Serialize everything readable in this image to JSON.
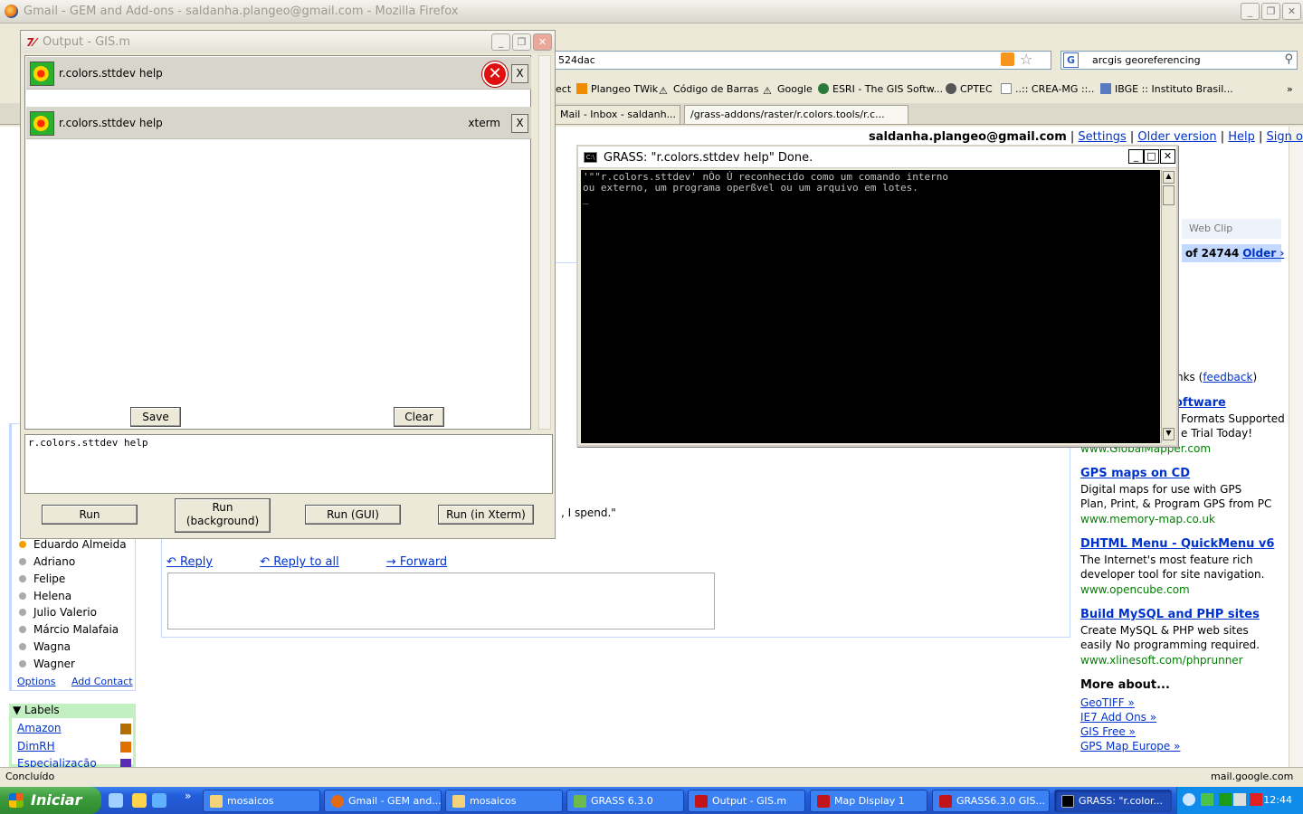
{
  "firefox": {
    "title": "Gmail - GEM and Add-ons - saldanha.plangeo@gmail.com - Mozilla Firefox",
    "url": "524dac",
    "search_value": "arcgis georeferencing",
    "bookmarks": [
      "ect",
      "Plangeo TWik",
      "Código de Barras",
      "Google",
      "ESRI - The GIS Softw...",
      "CPTEC",
      "..:: CREA-MG ::..",
      "IBGE :: Instituto Brasil..."
    ],
    "tabs": [
      "Mail - Inbox - saldanh...",
      "/grass-addons/raster/r.colors.tools/r.c..."
    ],
    "status_left": "Concluído",
    "status_right": "mail.google.com"
  },
  "gmail": {
    "account": "saldanha.plangeo@gmail.com",
    "links": [
      "Settings",
      "Older version",
      "Help",
      "Sign out"
    ],
    "web_clip": "Web Clip",
    "pager_count": "of 24744",
    "pager_older": "Older ›",
    "links_feedback_prefix": "nks",
    "links_feedback": "feedback",
    "spend_text": ", I spend.\"",
    "reply": "Reply",
    "reply_all": "Reply to all",
    "forward": "Forward",
    "contacts": [
      "Eduardo Almeida",
      "Adriano",
      "Felipe",
      "Helena",
      "Julio Valerio",
      "Márcio Malafaia",
      "Wagna",
      "Wagner"
    ],
    "options": "Options",
    "add_contact": "Add Contact",
    "labels_title": "Labels",
    "labels": [
      {
        "name": "Amazon",
        "color": "#b36d00"
      },
      {
        "name": "DimRH",
        "color": "#e07000"
      },
      {
        "name": "Especialização",
        "color": "#5a2bb3"
      }
    ],
    "ads": [
      {
        "title": "oftware",
        "lines": [
          "Formats Supported",
          "e Trial Today!"
        ],
        "url": "www.GlobalMapper.com"
      },
      {
        "title": "GPS maps on CD",
        "lines": [
          "Digital maps for use with GPS",
          "Plan, Print, & Program GPS from PC"
        ],
        "url": "www.memory-map.co.uk"
      },
      {
        "title": "DHTML Menu - QuickMenu v6",
        "lines": [
          "The Internet's most feature rich",
          "developer tool for site navigation."
        ],
        "url": "www.opencube.com"
      },
      {
        "title": "Build MySQL and PHP sites",
        "lines": [
          "Create MySQL & PHP web sites",
          "easily No programming required."
        ],
        "url": "www.xlinesoft.com/phprunner"
      }
    ],
    "more_about": "More about...",
    "more_links": [
      "GeoTIFF »",
      "IE7 Add Ons »",
      "GIS Free »",
      "GPS Map Europe »"
    ]
  },
  "output_window": {
    "title": "Output - GIS.m",
    "rows": [
      {
        "label": "r.colors.sttdev help",
        "button": "X"
      },
      {
        "label": "r.colors.sttdev help",
        "tag": "xterm",
        "button": "X"
      }
    ],
    "save": "Save",
    "clear": "Clear",
    "command": "r.colors.sttdev help",
    "run": "Run",
    "run_background": "Run\n(background)",
    "run_gui": "Run (GUI)",
    "run_xterm": "Run (in Xterm)"
  },
  "console": {
    "title": "GRASS: \"r.colors.sttdev help\" Done.",
    "text": "'\"\"r.colors.sttdev' nÒo Ú reconhecido como um comando interno\nou externo, um programa operßvel ou um arquivo em lotes.\n_"
  },
  "taskbar": {
    "start": "Iniciar",
    "tasks": [
      "mosaicos",
      "Gmail - GEM and...",
      "mosaicos",
      "GRASS 6.3.0",
      "Output - GIS.m",
      "Map Display 1",
      "GRASS6.3.0 GIS...",
      "GRASS: \"r.color..."
    ],
    "clock": "12:44"
  }
}
